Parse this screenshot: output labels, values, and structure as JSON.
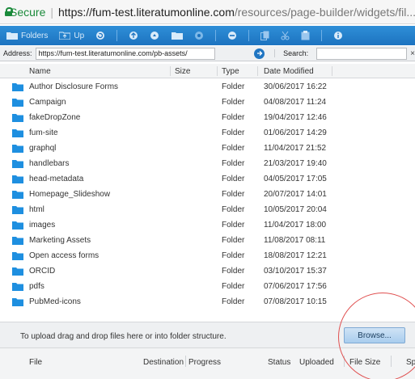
{
  "urlbar": {
    "secure_label": "Secure",
    "separator": "|",
    "url_scheme_host": "https://fum-test.literatumonline.com",
    "url_path": "/resources/page-builder/widgets/fil..."
  },
  "toolbar": {
    "folders_label": "Folders",
    "up_label": "Up",
    "icons": [
      "folders-icon",
      "folder-up-icon",
      "refresh-icon",
      "arrow-up-icon",
      "upload-icon",
      "new-folder-icon",
      "settings-icon",
      "remove-icon",
      "copy-icon",
      "cut-icon",
      "paste-icon",
      "info-icon"
    ]
  },
  "address_bar": {
    "address_label": "Address:",
    "address_value": "https://fum-test.literatumonline.com/pb-assets/",
    "search_label": "Search:",
    "search_value": "",
    "clear_label": "×"
  },
  "file_table": {
    "columns": [
      "Name",
      "Size",
      "Type",
      "Date Modified"
    ],
    "rows": [
      {
        "name": "Author Disclosure Forms",
        "size": "",
        "type": "Folder",
        "date": "30/06/2017 16:22"
      },
      {
        "name": "Campaign",
        "size": "",
        "type": "Folder",
        "date": "04/08/2017 11:24"
      },
      {
        "name": "fakeDropZone",
        "size": "",
        "type": "Folder",
        "date": "19/04/2017 12:46"
      },
      {
        "name": "fum-site",
        "size": "",
        "type": "Folder",
        "date": "01/06/2017 14:29"
      },
      {
        "name": "graphql",
        "size": "",
        "type": "Folder",
        "date": "11/04/2017 21:52"
      },
      {
        "name": "handlebars",
        "size": "",
        "type": "Folder",
        "date": "21/03/2017 19:40"
      },
      {
        "name": "head-metadata",
        "size": "",
        "type": "Folder",
        "date": "04/05/2017 17:05"
      },
      {
        "name": "Homepage_Slideshow",
        "size": "",
        "type": "Folder",
        "date": "20/07/2017 14:01"
      },
      {
        "name": "html",
        "size": "",
        "type": "Folder",
        "date": "10/05/2017 20:04"
      },
      {
        "name": "images",
        "size": "",
        "type": "Folder",
        "date": "11/04/2017 18:00"
      },
      {
        "name": "Marketing Assets",
        "size": "",
        "type": "Folder",
        "date": "11/08/2017 08:11"
      },
      {
        "name": "Open access forms",
        "size": "",
        "type": "Folder",
        "date": "18/08/2017 12:21"
      },
      {
        "name": "ORCID",
        "size": "",
        "type": "Folder",
        "date": "03/10/2017 15:37"
      },
      {
        "name": "pdfs",
        "size": "",
        "type": "Folder",
        "date": "07/06/2017 17:56"
      },
      {
        "name": "PubMed-icons",
        "size": "",
        "type": "Folder",
        "date": "07/08/2017 10:15"
      }
    ]
  },
  "upload": {
    "hint": "To upload drag and drop files here or into folder structure.",
    "browse_label": "Browse...",
    "columns": [
      "File",
      "Destination",
      "Progress",
      "Status",
      "Uploaded",
      "File Size",
      "Sp"
    ]
  },
  "colors": {
    "toolbar": "#1c73c0",
    "folder": "#1e8fe0",
    "secure": "#1a8a3a",
    "highlight": "#e05050"
  }
}
